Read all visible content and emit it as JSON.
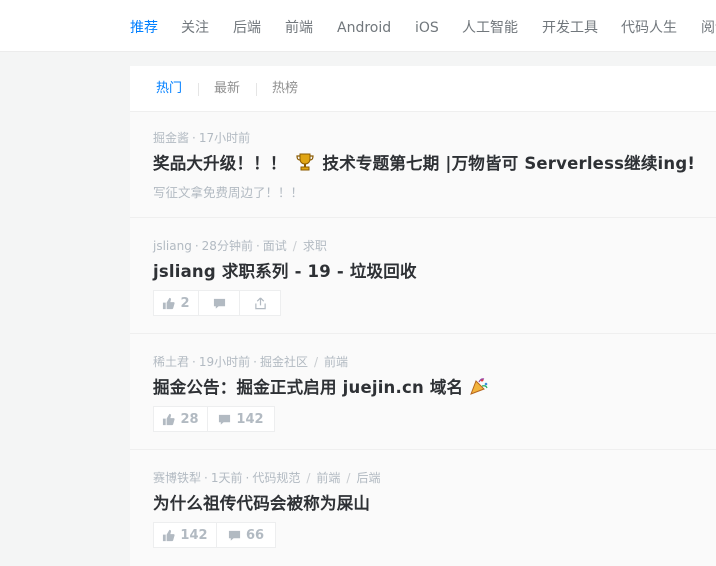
{
  "topnav": {
    "items": [
      "推荐",
      "关注",
      "后端",
      "前端",
      "Android",
      "iOS",
      "人工智能",
      "开发工具",
      "代码人生",
      "阅读"
    ]
  },
  "subtabs": {
    "items": [
      "热门",
      "最新",
      "热榜"
    ]
  },
  "entries": [
    {
      "author": "掘金酱",
      "time": "17小时前",
      "title_before": "奖品大升级！！！",
      "title_after": "技术专题第七期 |万物皆可 Serverless继续ing!",
      "desc": "写征文拿免费周边了！！！"
    },
    {
      "author": "jsliang",
      "time": "28分钟前",
      "tags": [
        "面试",
        "求职"
      ],
      "title": "jsliang 求职系列 - 19 - 垃圾回收",
      "likes": "2"
    },
    {
      "author": "稀土君",
      "time": "19小时前",
      "tags": [
        "掘金社区",
        "前端"
      ],
      "title": "掘金公告：掘金正式启用 juejin.cn 域名",
      "likes": "28",
      "comments": "142"
    },
    {
      "author": "赛博铁犁",
      "time": "1天前",
      "tags": [
        "代码规范",
        "前端",
        "后端"
      ],
      "title": "为什么祖传代码会被称为屎山",
      "likes": "142",
      "comments": "66"
    }
  ],
  "colors": {
    "accent": "#007fff",
    "text_dark": "#2e3135",
    "text_light": "#b2bac2",
    "background": "#f4f5f5"
  },
  "icons": [
    "trophy-icon",
    "party-popper-icon",
    "like-icon",
    "comment-icon",
    "share-icon"
  ]
}
